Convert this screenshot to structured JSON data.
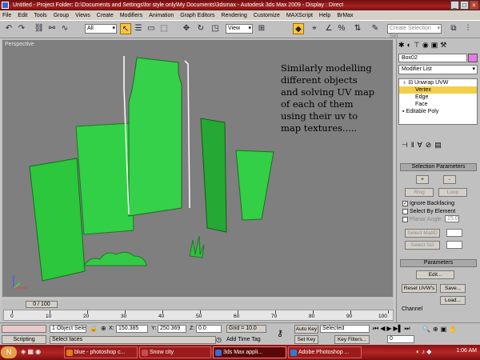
{
  "window": {
    "title": "Untitled    - Project Folder: D:\\Documents and Settings\\for style only\\My Documents\\3dsmax    - Autodesk 3ds Max 2009    - Display : Direct"
  },
  "menu": [
    "File",
    "Edit",
    "Tools",
    "Group",
    "Views",
    "Create",
    "Modifiers",
    "Animation",
    "Graph Editors",
    "Rendering",
    "Customize",
    "MAXScript",
    "Help",
    "BrMax"
  ],
  "toolbar": {
    "filter": "All",
    "view": "View",
    "selection_set_placeholder": "Create Selection Set"
  },
  "viewport": {
    "label": "Perspective",
    "annotation": [
      "Similarly modelling",
      "different objects",
      "and solving UV map",
      "of each of them",
      "using their uv to",
      "map textures....."
    ]
  },
  "command_panel": {
    "object_name": "Box02",
    "object_color": "#e47be4",
    "modifier_list": "Modifier List",
    "stack": [
      {
        "label": "Unwrap UVW",
        "level": 0
      },
      {
        "label": "Vertex",
        "level": 2
      },
      {
        "label": "Edge",
        "level": 2
      },
      {
        "label": "Face",
        "level": 2
      },
      {
        "label": "Editable Poly",
        "level": 0
      }
    ],
    "selection_params": {
      "title": "Selection Parameters",
      "plus": "+",
      "minus": "-",
      "ring": "Ring",
      "loop": "Loop",
      "ignore_backfacing": "Ignore Backfacing",
      "select_by_element": "Select By Element",
      "planar_angle": "Planar Angle:",
      "planar_angle_value": "15.0",
      "select_matid": "Select MatID",
      "select_sg": "Select SG"
    },
    "parameters": {
      "title": "Parameters",
      "edit": "Edit...",
      "reset_uvws": "Reset UVW's",
      "save": "Save...",
      "load": "Load...",
      "channel": "Channel"
    }
  },
  "timeline": {
    "slider": "0 / 100",
    "ticks": [
      "0",
      "10",
      "20",
      "30",
      "40",
      "50",
      "60",
      "70",
      "80",
      "90",
      "100"
    ]
  },
  "status": {
    "scripting": "Scripting",
    "selection": "1 Object Sele",
    "x_label": "X:",
    "x_value": "150.385",
    "y_label": "Y:",
    "y_value": "250.369",
    "z_label": "Z:",
    "z_value": "0.0",
    "grid": "Grid = 10.0",
    "prompt": "Select faces",
    "add_time_tag": "Add Time Tag",
    "auto_key": "Auto Key",
    "selected": "Selected",
    "set_key": "Set Key",
    "key_filters": "Key Filters...",
    "frame": "0"
  },
  "taskbar": {
    "tasks": [
      {
        "label": "blue - photoshop c...",
        "color": "#e07a1a"
      },
      {
        "label": "Snow city",
        "color": "#c74b4b"
      },
      {
        "label": "3ds Max appli...",
        "color": "#3a6bd0"
      },
      {
        "label": "Adobe Photoshop ...",
        "color": "#2a7fd0"
      }
    ],
    "clock": "1:06 AM"
  }
}
